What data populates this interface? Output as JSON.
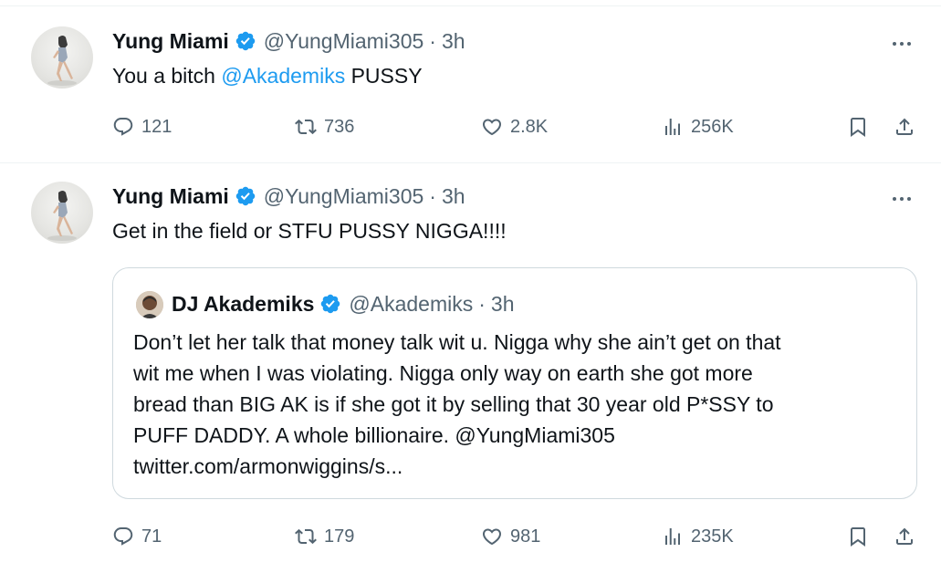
{
  "tweets": [
    {
      "author": {
        "name": "Yung Miami",
        "handle": "@YungMiami305",
        "separator": "·",
        "time": "3h"
      },
      "text_before": "You a bitch ",
      "mention": "@Akademiks",
      "text_after": " PUSSY",
      "stats": {
        "replies": "121",
        "retweets": "736",
        "likes": "2.8K",
        "views": "256K"
      }
    },
    {
      "author": {
        "name": "Yung Miami",
        "handle": "@YungMiami305",
        "separator": "·",
        "time": "3h"
      },
      "text": "Get in the field or STFU PUSSY NIGGA!!!!",
      "quote": {
        "author": {
          "name": "DJ Akademiks",
          "handle": "@Akademiks",
          "separator": "·",
          "time": "3h"
        },
        "lines": [
          "Don’t let her talk that money talk wit u. Nigga why she ain’t get on that",
          "wit me when I was violating. Nigga only way on earth she got more",
          "bread than BIG AK is if she got it by selling that 30 year old P*SSY to",
          "PUFF DADDY. A whole billionaire. @YungMiami305",
          "twitter.com/armonwiggins/s..."
        ]
      },
      "stats": {
        "replies": "71",
        "retweets": "179",
        "likes": "981",
        "views": "235K"
      }
    }
  ],
  "icons": {
    "reply": "reply-icon",
    "retweet": "retweet-icon",
    "like": "like-icon",
    "views": "views-icon",
    "bookmark": "bookmark-icon",
    "share": "share-icon",
    "verified": "verified-badge-icon",
    "more": "more-icon"
  },
  "colors": {
    "accent": "#1d9bf0",
    "secondary_text": "#536471",
    "border": "#cfd9de"
  }
}
